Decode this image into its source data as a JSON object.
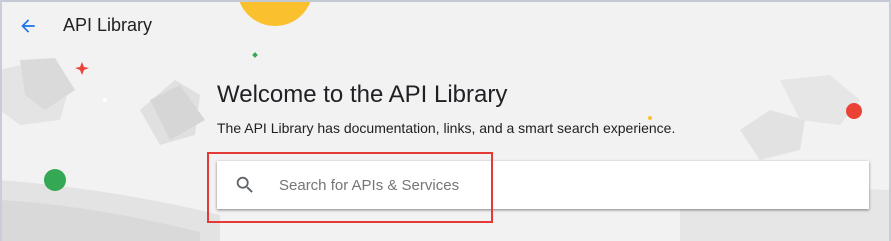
{
  "header": {
    "back_icon": "arrow-left-icon",
    "title": "API Library"
  },
  "hero": {
    "heading": "Welcome to the API Library",
    "subtitle": "The API Library has documentation, links, and a smart search experience."
  },
  "search": {
    "icon": "search-icon",
    "placeholder": "Search for APIs & Services",
    "value": ""
  },
  "colors": {
    "accent_blue": "#1a73e8",
    "highlight_red": "#e53935",
    "deco_yellow": "#fbc02d",
    "deco_green": "#34a853",
    "deco_red": "#ea4335"
  }
}
